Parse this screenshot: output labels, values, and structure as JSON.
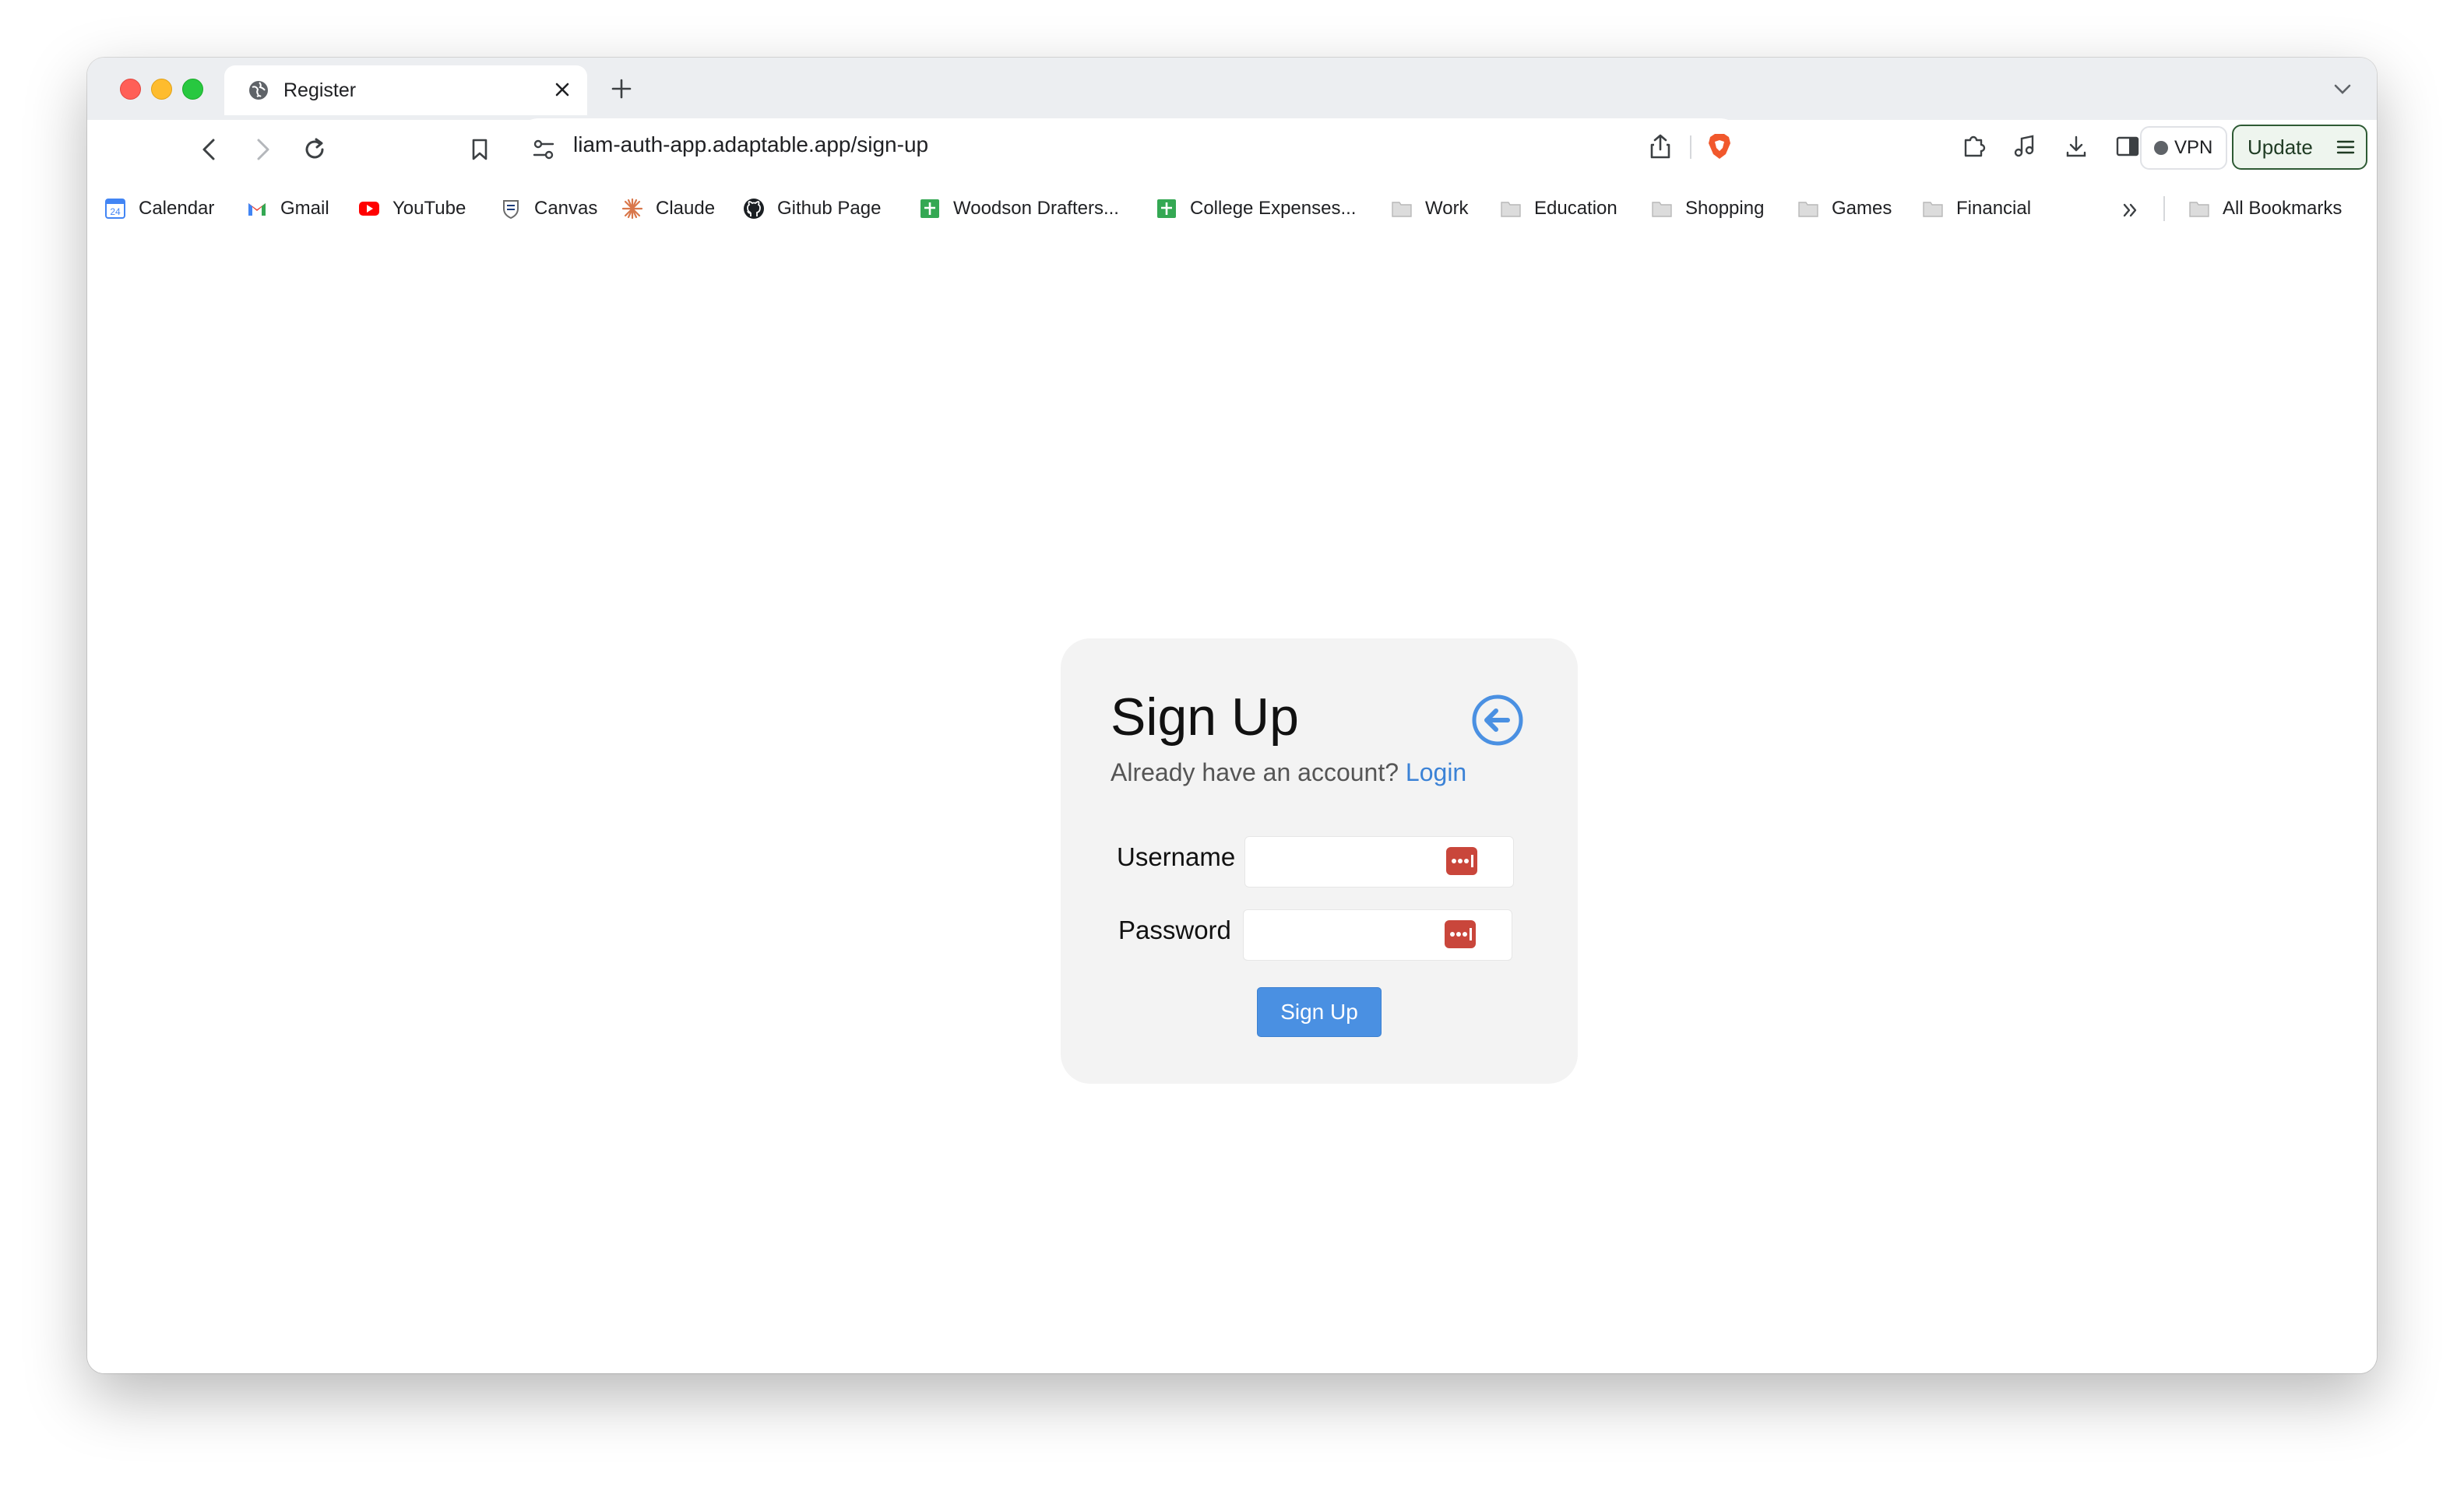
{
  "browser": {
    "tab": {
      "title": "Register",
      "favicon": "globe-icon"
    },
    "address_bar": {
      "url": "liam-auth-app.adaptable.app/sign-up"
    },
    "vpn_label": "VPN",
    "update_label": "Update",
    "bookmarks": [
      {
        "label": "Calendar",
        "icon": "calendar-icon"
      },
      {
        "label": "Gmail",
        "icon": "gmail-icon"
      },
      {
        "label": "YouTube",
        "icon": "youtube-icon"
      },
      {
        "label": "Canvas",
        "icon": "canvas-icon"
      },
      {
        "label": "Claude",
        "icon": "claude-icon"
      },
      {
        "label": "Github Page",
        "icon": "github-icon"
      },
      {
        "label": "Woodson Drafters...",
        "icon": "sheets-icon"
      },
      {
        "label": "College Expenses...",
        "icon": "sheets-icon"
      },
      {
        "label": "Work",
        "icon": "folder-icon"
      },
      {
        "label": "Education",
        "icon": "folder-icon"
      },
      {
        "label": "Shopping",
        "icon": "folder-icon"
      },
      {
        "label": "Games",
        "icon": "folder-icon"
      },
      {
        "label": "Financial",
        "icon": "folder-icon"
      }
    ],
    "all_bookmarks_label": "All Bookmarks",
    "colors": {
      "chrome_bg": "#eceef1",
      "accent_blue": "#4a90e2",
      "link_blue": "#3b82d6",
      "password_key_red": "#c9463b"
    }
  },
  "page": {
    "title": "Sign Up",
    "subtitle_prefix": "Already have an account?",
    "login_link": "Login",
    "fields": {
      "username_label": "Username",
      "username_value": "",
      "password_label": "Password",
      "password_value": ""
    },
    "submit_label": "Sign Up"
  }
}
